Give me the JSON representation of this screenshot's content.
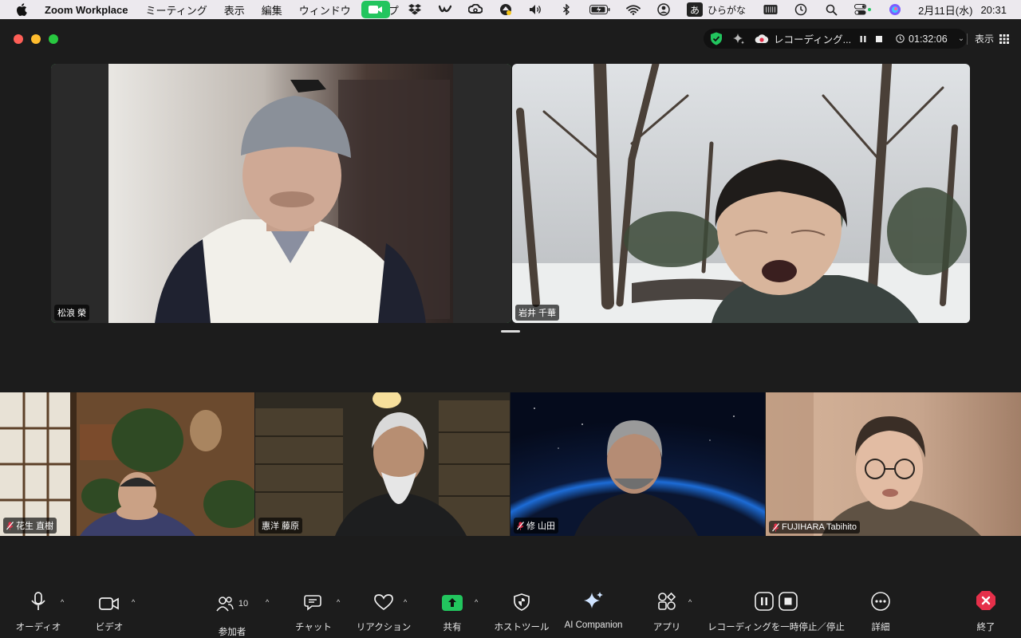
{
  "menubar": {
    "app_name": "Zoom Workplace",
    "items": [
      "ミーティング",
      "表示",
      "編集",
      "ウィンドウ",
      "ヘルプ"
    ],
    "ime_char": "あ",
    "ime_label": "ひらがな",
    "date": "2月11日(水)",
    "time": "20:31"
  },
  "status": {
    "recording_label": "レコーディング...",
    "timer": "01:32:06",
    "view_label": "表示"
  },
  "participants": {
    "top": [
      {
        "name": "松浪 榮",
        "active": true
      },
      {
        "name": "岩井 千華",
        "active": false
      }
    ],
    "bottom": [
      {
        "name": "花生 直樹",
        "muted": true
      },
      {
        "name": "惠洋 藤原",
        "muted": false
      },
      {
        "name": "修 山田",
        "muted": true
      },
      {
        "name": "FUJIHARA Tabihito",
        "muted": true
      }
    ]
  },
  "toolbar": {
    "audio": "オーディオ",
    "video": "ビデオ",
    "participants": "参加者",
    "participants_count": "10",
    "chat": "チャット",
    "reactions": "リアクション",
    "share": "共有",
    "host_tools": "ホストツール",
    "ai_companion": "AI Companion",
    "apps": "アプリ",
    "recording": "レコーディングを一時停止／停止",
    "more": "詳細",
    "end": "終了"
  },
  "colors": {
    "active_speaker": "#4cd964",
    "share_green": "#22c55e",
    "end_red": "#e5304a"
  }
}
